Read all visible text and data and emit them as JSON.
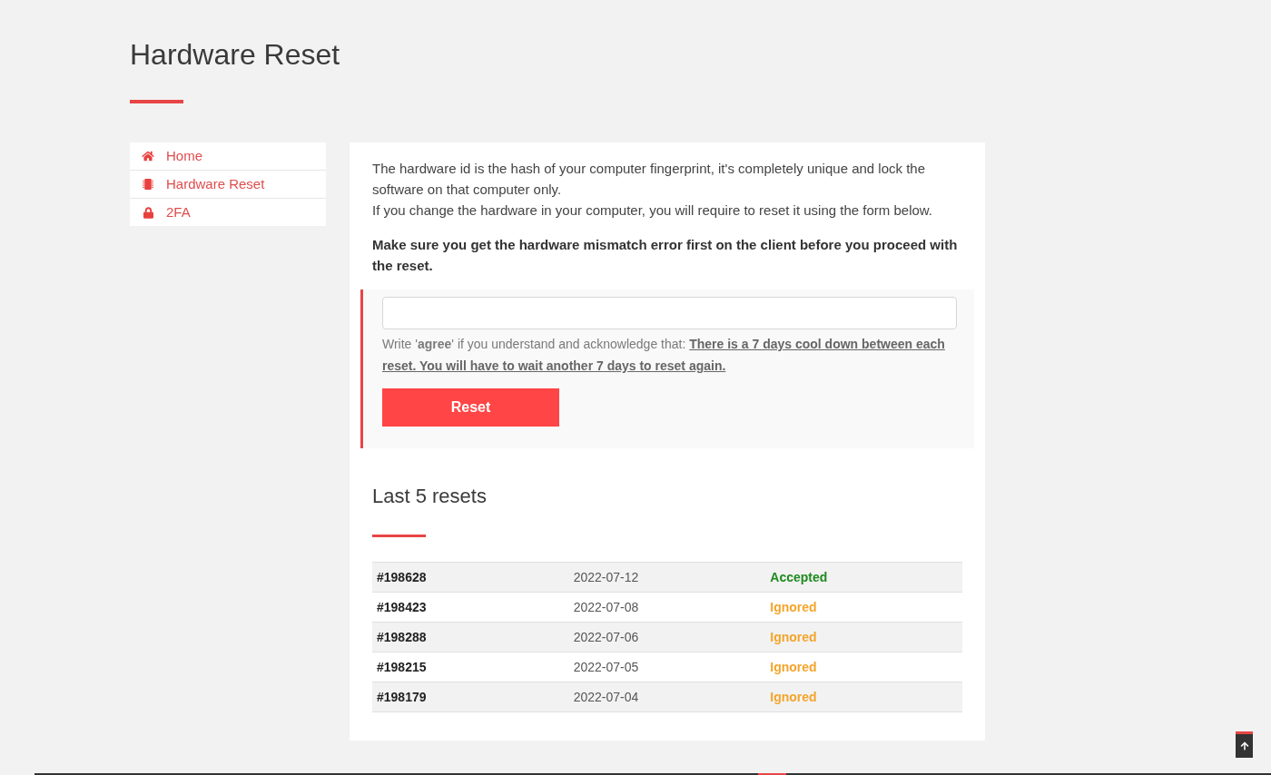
{
  "page": {
    "title": "Hardware Reset"
  },
  "sidebar": {
    "items": [
      {
        "label": "Home",
        "kind": "home"
      },
      {
        "label": "Hardware Reset",
        "kind": "hardware"
      },
      {
        "label": "2FA",
        "kind": "lock"
      }
    ]
  },
  "content": {
    "intro": [
      "The hardware id is the hash of your computer fingerprint, it's completely unique and lock the software on that computer only.",
      "If you change the hardware in your computer, you will require to reset it using the form below."
    ],
    "warning": "Make sure you get the hardware mismatch error first on the client before you proceed with the reset.",
    "reset_form": {
      "instructions": "Write '**agree**' if you understand and acknowledge that:",
      "notice": "There is a 7 days cool down between each reset. You will have to wait another 7 days to reset again.",
      "button": "Reset"
    },
    "history": {
      "title": "Last 5 resets",
      "rows": [
        {
          "id": "#198628",
          "date": "2022-07-12",
          "status": "Accepted",
          "color": "#1f8a1f"
        },
        {
          "id": "#198423",
          "date": "2022-07-08",
          "status": "Ignored",
          "color": "#f4a52b"
        },
        {
          "id": "#198288",
          "date": "2022-07-06",
          "status": "Ignored",
          "color": "#f4a52b"
        },
        {
          "id": "#198215",
          "date": "2022-07-05",
          "status": "Ignored",
          "color": "#f4a52b"
        },
        {
          "id": "#198179",
          "date": "2022-07-04",
          "status": "Ignored",
          "color": "#f4a52b"
        }
      ]
    }
  }
}
